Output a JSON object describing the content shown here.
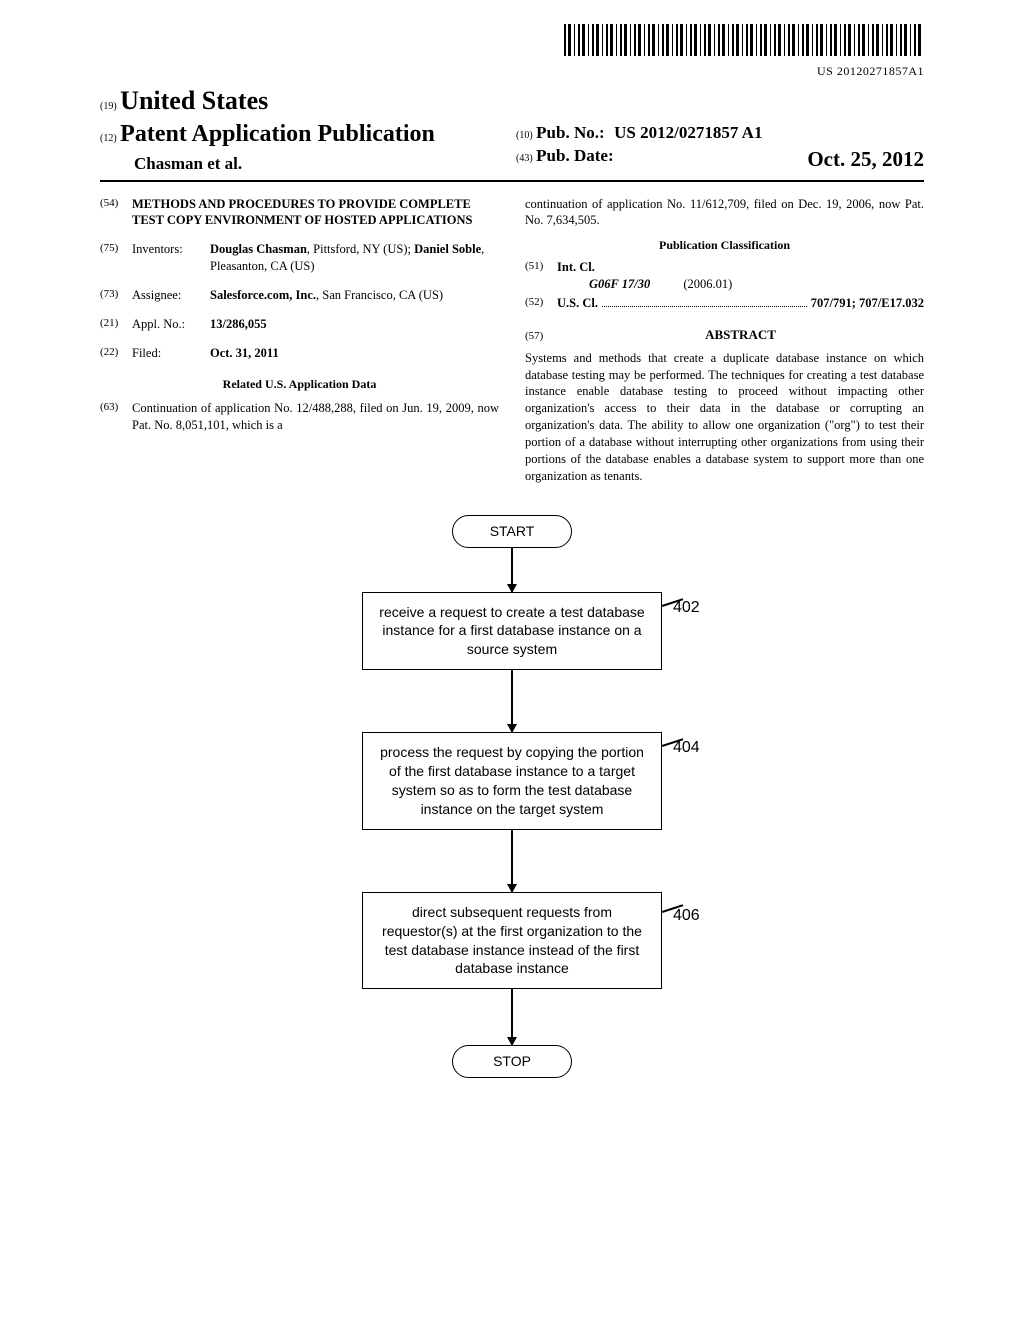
{
  "barcode_text": "US 20120271857A1",
  "header": {
    "country_inid": "(19)",
    "country": "United States",
    "pub_type_inid": "(12)",
    "pub_type": "Patent Application Publication",
    "authors_line": "Chasman et al.",
    "pub_no_inid": "(10)",
    "pub_no_label": "Pub. No.:",
    "pub_no": "US 2012/0271857 A1",
    "pub_date_inid": "(43)",
    "pub_date_label": "Pub. Date:",
    "pub_date": "Oct. 25, 2012"
  },
  "left_col": {
    "title_inid": "(54)",
    "title": "METHODS AND PROCEDURES TO PROVIDE COMPLETE TEST COPY ENVIRONMENT OF HOSTED APPLICATIONS",
    "inventors_inid": "(75)",
    "inventors_label": "Inventors:",
    "inventors_value_html": "<b>Douglas Chasman</b>, Pittsford, NY (US); <b>Daniel Soble</b>, Pleasanton, CA (US)",
    "assignee_inid": "(73)",
    "assignee_label": "Assignee:",
    "assignee_value_html": "<b>Salesforce.com, Inc.</b>, San Francisco, CA (US)",
    "appl_inid": "(21)",
    "appl_label": "Appl. No.:",
    "appl_value": "13/286,055",
    "filed_inid": "(22)",
    "filed_label": "Filed:",
    "filed_value": "Oct. 31, 2011",
    "related_header": "Related U.S. Application Data",
    "related_inid": "(63)",
    "related_text": "Continuation of application No. 12/488,288, filed on Jun. 19, 2009, now Pat. No. 8,051,101, which is a"
  },
  "right_col": {
    "related_cont": "continuation of application No. 11/612,709, filed on Dec. 19, 2006, now Pat. No. 7,634,505.",
    "pub_class_header": "Publication Classification",
    "intcl_inid": "(51)",
    "intcl_label": "Int. Cl.",
    "intcl_class": "G06F 17/30",
    "intcl_date": "(2006.01)",
    "uscl_inid": "(52)",
    "uscl_label": "U.S. Cl.",
    "uscl_value": "707/791; 707/E17.032",
    "abstract_inid": "(57)",
    "abstract_header": "ABSTRACT",
    "abstract_text": "Systems and methods that create a duplicate database instance on which database testing may be performed. The techniques for creating a test database instance enable database testing to proceed without impacting other organization's access to their data in the database or corrupting an organization's data. The ability to allow one organization (\"org\") to test their portion of a database without interrupting other organizations from using their portions of the database enables a database system to support more than one organization as tenants."
  },
  "flowchart": {
    "start": "START",
    "stop": "STOP",
    "steps": [
      {
        "label": "402",
        "text": "receive a request to create a test database instance for a first database instance on a source system"
      },
      {
        "label": "404",
        "text": "process the request by copying the portion of the first database instance to a target system so as to form the test database instance on the target system"
      },
      {
        "label": "406",
        "text": "direct subsequent requests from requestor(s) at the first organization to the test database instance instead of the first database instance"
      }
    ]
  }
}
